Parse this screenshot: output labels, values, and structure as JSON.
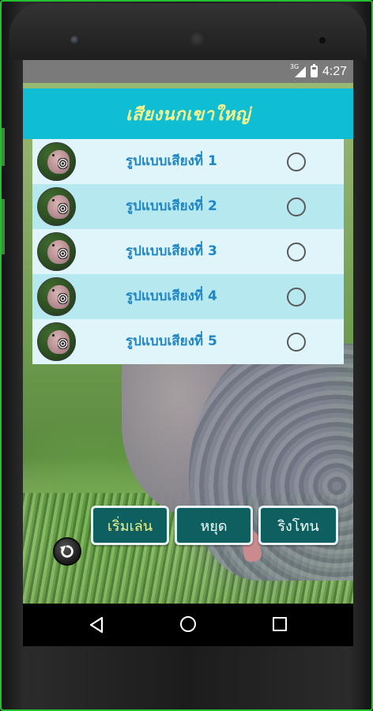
{
  "status_bar": {
    "network_label": "3G",
    "time": "4:27"
  },
  "header": {
    "title": "เสียงนกเขาใหญ่"
  },
  "sound_list": [
    {
      "label": "รูปแบบเสียงที่ 1",
      "selected": false
    },
    {
      "label": "รูปแบบเสียงที่ 2",
      "selected": false
    },
    {
      "label": "รูปแบบเสียงที่ 3",
      "selected": false
    },
    {
      "label": "รูปแบบเสียงที่ 4",
      "selected": false
    },
    {
      "label": "รูปแบบเสียงที่ 5",
      "selected": false
    }
  ],
  "controls": {
    "repeat_icon": "repeat-icon",
    "play_label": "เริ่มเล่น",
    "stop_label": "หยุด",
    "ringtone_label": "ริงโทน"
  },
  "navigation": {
    "back_icon": "back-triangle-icon",
    "home_icon": "home-circle-icon",
    "recents_icon": "recents-square-icon"
  },
  "colors": {
    "header_bg": "#10bed3",
    "header_text": "#f5f58c",
    "row_light": "#dff5f9",
    "row_dark": "#b6e8ef",
    "row_text": "#1f86c6",
    "button_bg": "#0e6060",
    "device_border": "#22c22e"
  }
}
